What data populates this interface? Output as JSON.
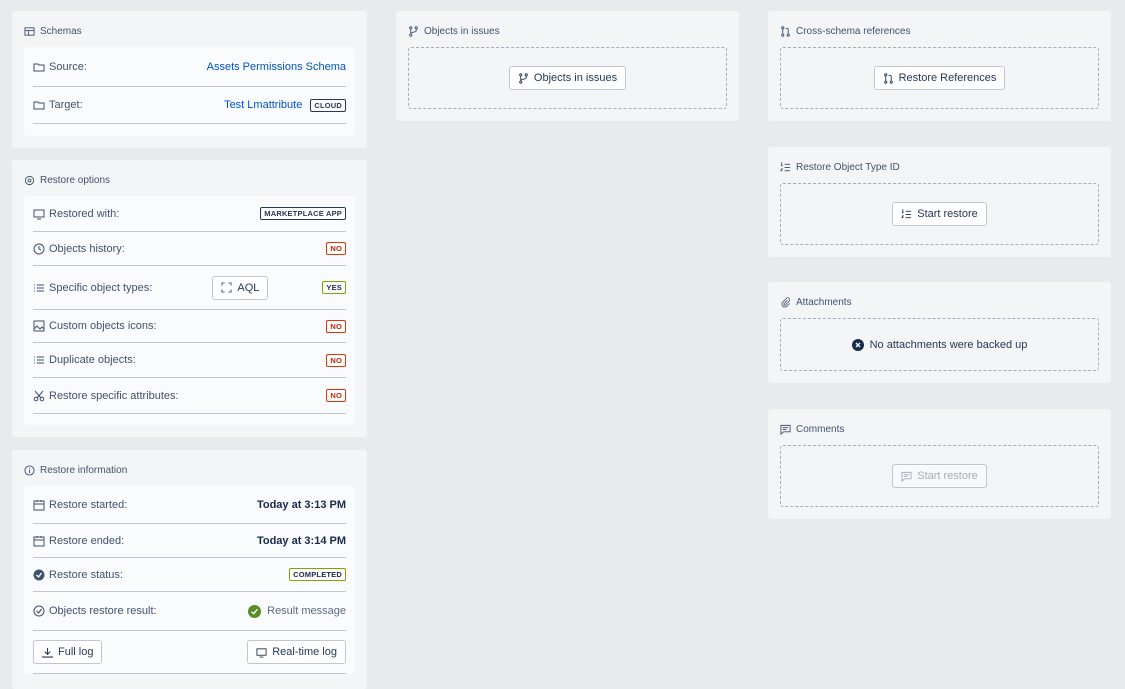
{
  "schemas": {
    "title": "Schemas",
    "source_label": "Source:",
    "source_value": "Assets Permissions Schema",
    "target_label": "Target:",
    "target_value": "Test Lmattribute",
    "target_badge": "CLOUD"
  },
  "restore_options": {
    "title": "Restore options",
    "rows": [
      {
        "label": "Restored with:",
        "badge": "MARKETPLACE APP",
        "icon": "monitor-icon"
      },
      {
        "label": "Objects history:",
        "badge": "NO",
        "icon": "clock-icon"
      },
      {
        "label": "Specific object types:",
        "badge": "YES",
        "icon": "list-icon",
        "button": "AQL"
      },
      {
        "label": "Custom objects icons:",
        "badge": "NO",
        "icon": "image-icon"
      },
      {
        "label": "Duplicate objects:",
        "badge": "NO",
        "icon": "list-icon"
      },
      {
        "label": "Restore specific attributes:",
        "badge": "NO",
        "icon": "scissors-icon"
      }
    ]
  },
  "restore_information": {
    "title": "Restore information",
    "started_label": "Restore started:",
    "started_value": "Today at 3:13 PM",
    "ended_label": "Restore ended:",
    "ended_value": "Today at 3:14 PM",
    "status_label": "Restore status:",
    "status_badge": "COMPLETED",
    "result_label": "Objects restore result:",
    "result_value": "Result message",
    "full_log": "Full log",
    "realtime_log": "Real-time log"
  },
  "objects_in_issues": {
    "title": "Objects in issues",
    "button": "Objects in issues"
  },
  "cross_schema": {
    "title": "Cross-schema references",
    "button": "Restore References"
  },
  "restore_type_id": {
    "title": "Restore Object Type ID",
    "button": "Start restore"
  },
  "attachments": {
    "title": "Attachments",
    "message": "No attachments were backed up"
  },
  "comments": {
    "title": "Comments",
    "button": "Start restore"
  },
  "colors": {
    "background": "#e8eaed",
    "card": "#f4f5f7",
    "link": "#0052cc",
    "success": "#5b8c29"
  }
}
